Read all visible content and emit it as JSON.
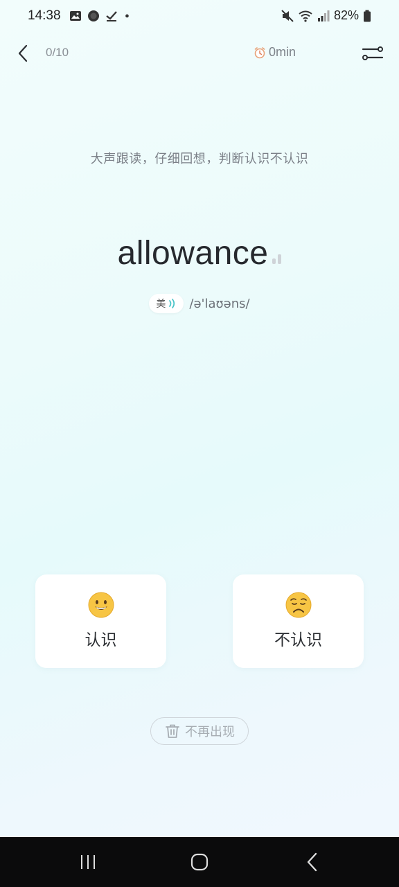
{
  "status_bar": {
    "time": "14:38",
    "battery": "82%",
    "left_icons": [
      "image-icon",
      "circle-app-icon",
      "check-icon",
      "dot-icon"
    ],
    "right_icons": [
      "mute-icon",
      "wifi-icon",
      "signal-icon",
      "battery-icon"
    ]
  },
  "header": {
    "progress": "0/10",
    "timer": "0min"
  },
  "instruction": "大声跟读，仔细回想，判断认识不认识",
  "word": {
    "text": "allowance",
    "accent": "美",
    "phonetic": "/ə'laʊəns/"
  },
  "choices": {
    "know_label": "认识",
    "unknown_label": "不认识"
  },
  "never_show": {
    "label": "不再出现"
  },
  "colors": {
    "accent_teal": "#4cc5c9",
    "emoji_yellow": "#f7c544"
  }
}
